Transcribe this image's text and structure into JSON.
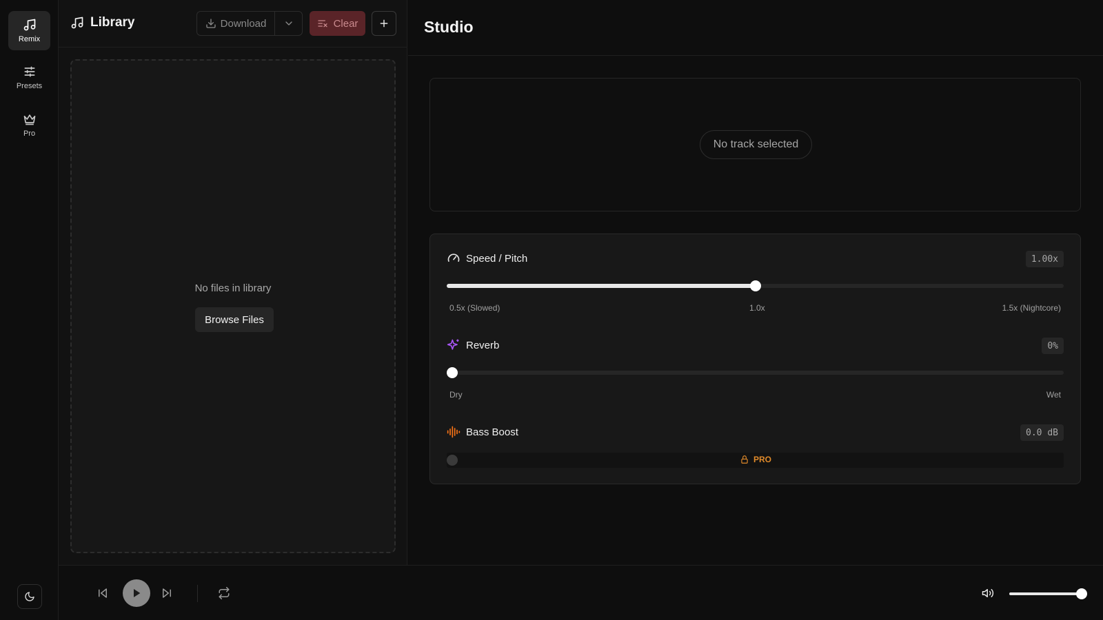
{
  "nav": {
    "items": [
      {
        "label": "Remix",
        "icon": "music-note-icon",
        "active": true
      },
      {
        "label": "Presets",
        "icon": "sliders-icon",
        "active": false
      },
      {
        "label": "Pro",
        "icon": "crown-icon",
        "active": false
      }
    ],
    "theme_icon": "moon-icon"
  },
  "library": {
    "title": "Library",
    "download_label": "Download",
    "clear_label": "Clear",
    "empty_text": "No files in library",
    "browse_label": "Browse Files"
  },
  "studio": {
    "title": "Studio",
    "track_status": "No track selected",
    "speed": {
      "title": "Speed / Pitch",
      "value_label": "1.00x",
      "value": 1.0,
      "min": 0.5,
      "max": 1.5,
      "tick_left": "0.5x (Slowed)",
      "tick_center": "1.0x",
      "tick_right": "1.5x (Nightcore)"
    },
    "reverb": {
      "title": "Reverb",
      "value_label": "0%",
      "value": 0,
      "tick_left": "Dry",
      "tick_right": "Wet",
      "accent": "#a855f7"
    },
    "bass": {
      "title": "Bass Boost",
      "value_label": "0.0 dB",
      "locked_label": "PRO",
      "accent": "#f97316",
      "lock_color": "#e08a2a"
    }
  },
  "player": {
    "volume": 1.0
  }
}
